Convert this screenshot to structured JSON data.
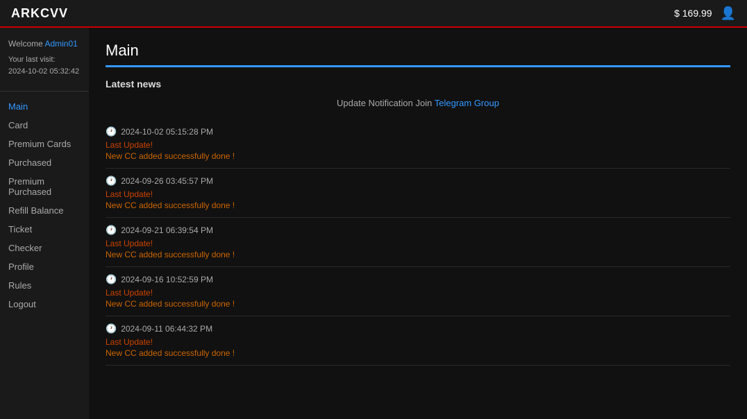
{
  "navbar": {
    "brand": "ARKCVV",
    "balance": "$ 169.99",
    "user_icon": "👤"
  },
  "sidebar": {
    "welcome_text": "Welcome",
    "username": "Admin01",
    "last_visit_label": "Your last visit:",
    "last_visit_date": "2024-10-02 05:32:42",
    "nav_items": [
      {
        "label": "Main",
        "active": true
      },
      {
        "label": "Card",
        "active": false
      },
      {
        "label": "Premium Cards",
        "active": false
      },
      {
        "label": "Purchased",
        "active": false
      },
      {
        "label": "Premium Purchased",
        "active": false
      },
      {
        "label": "Refill Balance",
        "active": false
      },
      {
        "label": "Ticket",
        "active": false
      },
      {
        "label": "Checker",
        "active": false
      },
      {
        "label": "Profile",
        "active": false
      },
      {
        "label": "Rules",
        "active": false
      },
      {
        "label": "Logout",
        "active": false
      }
    ]
  },
  "main": {
    "page_title": "Main",
    "latest_news_header": "Latest news",
    "notification_prefix": "Update Notification Join",
    "notification_link_text": "Telegram Group",
    "news_items": [
      {
        "timestamp": "2024-10-02 05:15:28 PM",
        "update_label": "Last Update!",
        "update_text": "New CC added successfully done !"
      },
      {
        "timestamp": "2024-09-26 03:45:57 PM",
        "update_label": "Last Update!",
        "update_text": "New CC added successfully done !"
      },
      {
        "timestamp": "2024-09-21 06:39:54 PM",
        "update_label": "Last Update!",
        "update_text": "New CC added successfully done !"
      },
      {
        "timestamp": "2024-09-16 10:52:59 PM",
        "update_label": "Last Update!",
        "update_text": "New CC added successfully done !"
      },
      {
        "timestamp": "2024-09-11 06:44:32 PM",
        "update_label": "Last Update!",
        "update_text": "New CC added successfully done !"
      }
    ]
  }
}
